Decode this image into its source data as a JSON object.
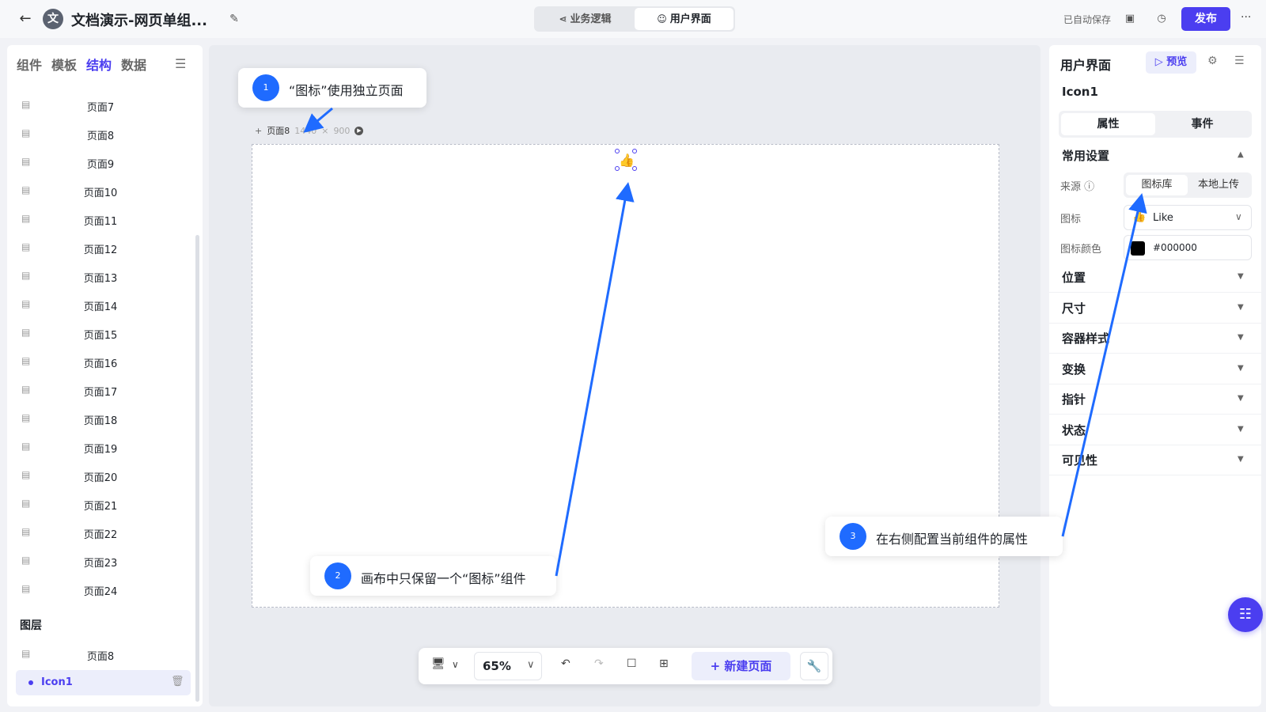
{
  "header": {
    "avatar_text": "文",
    "title": "文档演示-网页单组...",
    "modes": [
      {
        "label": "业务逻辑",
        "icon": "share-icon"
      },
      {
        "label": "用户界面",
        "icon": "user-icon"
      }
    ],
    "autosave": "已自动保存",
    "publish_label": "发布"
  },
  "left": {
    "tabs": [
      "组件",
      "模板",
      "结构",
      "数据"
    ],
    "active_tab": "结构",
    "pages": [
      "页面7",
      "页面8",
      "页面9",
      "页面10",
      "页面11",
      "页面12",
      "页面13",
      "页面14",
      "页面15",
      "页面16",
      "页面17",
      "页面18",
      "页面19",
      "页面20",
      "页面21",
      "页面22",
      "页面23",
      "页面24"
    ],
    "layers_title": "图层",
    "layer_page": "页面8",
    "layer_component": "Icon1"
  },
  "canvas": {
    "page_name": "页面8",
    "width": "1440",
    "height": "900"
  },
  "toolbar": {
    "zoom": "65%",
    "new_page_label": "新建页面"
  },
  "right": {
    "title": "用户界面",
    "preview_label": "预览",
    "component_name": "Icon1",
    "tabs": [
      "属性",
      "事件"
    ],
    "common_section": "常用设置",
    "source_label": "来源",
    "source_options": [
      "图标库",
      "本地上传"
    ],
    "icon_label": "图标",
    "icon_value": "Like",
    "icon_color_label": "图标颜色",
    "icon_color_value": "#000000",
    "sections": [
      "位置",
      "尺寸",
      "容器样式",
      "变换",
      "指针",
      "状态",
      "可见性"
    ]
  },
  "callouts": [
    {
      "num": "1",
      "text": "“图标”使用独立页面"
    },
    {
      "num": "2",
      "text": "画布中只保留一个“图标”组件"
    },
    {
      "num": "3",
      "text": "在右侧配置当前组件的属性"
    }
  ],
  "colors": {
    "accent": "#4b3ef0",
    "callout_blue": "#1f6bff"
  }
}
